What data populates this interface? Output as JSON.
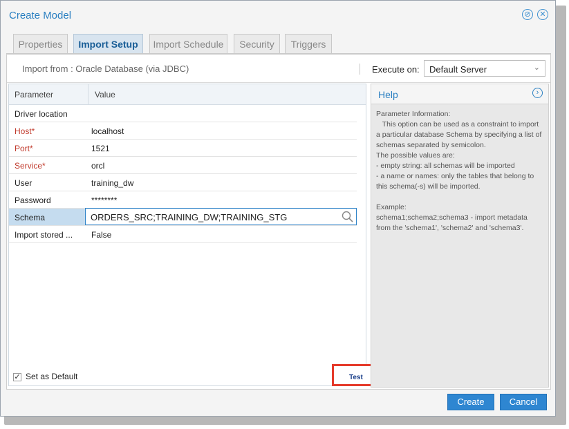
{
  "dialog": {
    "title": "Create Model"
  },
  "tabs": [
    {
      "label": "Properties",
      "active": false
    },
    {
      "label": "Import Setup",
      "active": true
    },
    {
      "label": "Import Schedule",
      "active": false
    },
    {
      "label": "Security",
      "active": false
    },
    {
      "label": "Triggers",
      "active": false
    }
  ],
  "import_bar": {
    "import_from": "Import from : Oracle Database (via JDBC)",
    "execute_label": "Execute on:",
    "execute_value": "Default Server"
  },
  "grid": {
    "headers": {
      "parameter": "Parameter",
      "value": "Value"
    },
    "rows": [
      {
        "param": "Driver location",
        "value": "",
        "required": false
      },
      {
        "param": "Host*",
        "value": "localhost",
        "required": true
      },
      {
        "param": "Port*",
        "value": "1521",
        "required": true
      },
      {
        "param": "Service*",
        "value": "orcl",
        "required": true
      },
      {
        "param": "User",
        "value": "training_dw",
        "required": false
      },
      {
        "param": "Password",
        "value": "********",
        "required": false
      },
      {
        "param": "Schema",
        "value": "ORDERS_SRC;TRAINING_DW;TRAINING_STG",
        "required": false,
        "selected": true
      },
      {
        "param": "Import stored ...",
        "value": "False",
        "required": false
      }
    ]
  },
  "set_default": {
    "label": "Set as Default",
    "checked": true
  },
  "test_button": {
    "label": "Test"
  },
  "help": {
    "title": "Help",
    "text": "Parameter Information:\n   This option can be used as a constraint to import a particular database Schema by specifying a list of schemas separated by semicolon.\nThe possible values are:\n- empty string: all schemas will be imported\n- a name or names: only the tables that belong to this schema(-s) will be imported.\n\nExample:\nschema1;schema2;schema3 - import metadata from the 'schema1', 'schema2' and 'schema3'."
  },
  "footer": {
    "create_label": "Create",
    "cancel_label": "Cancel"
  },
  "colors": {
    "accent": "#2e86d1",
    "title": "#2a7fc1",
    "required": "#c0392b",
    "highlight": "#e53a2a"
  }
}
